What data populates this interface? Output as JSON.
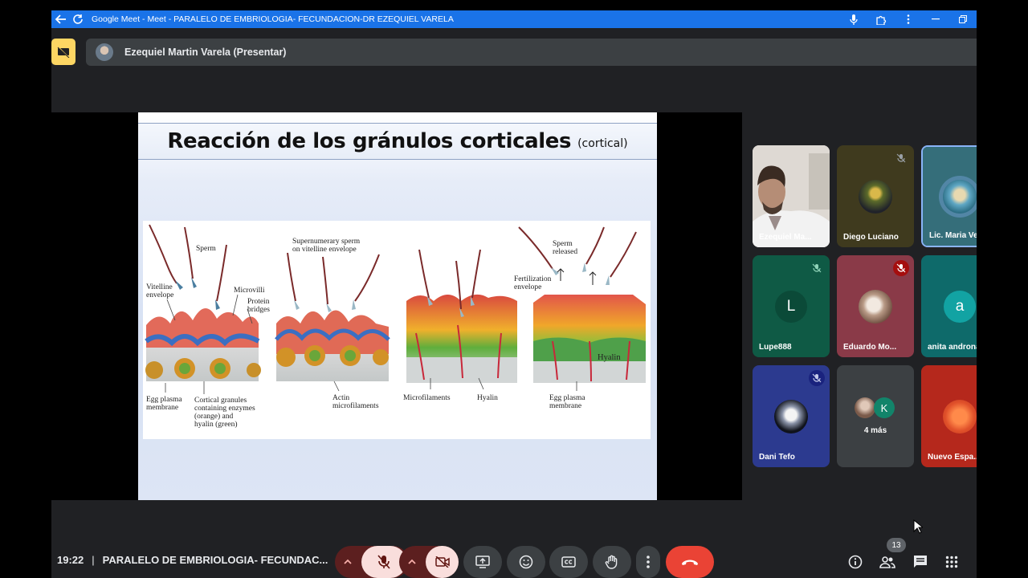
{
  "browser": {
    "title": "Google Meet - Meet - PARALELO DE EMBRIOLOGIA- FECUNDACION-DR EZEQUIEL VARELA",
    "back_icon": "arrow-left-icon",
    "reload_icon": "reload-icon",
    "accent_color": "#1a73e8"
  },
  "presenter": {
    "name": "Ezequiel Martin Varela (Presentar)",
    "toggle_color": "#fdd663"
  },
  "slide": {
    "title": "Reacción de los gránulos corticales",
    "title_suffix": "(cortical)",
    "figure_labels": {
      "sperm": "Sperm",
      "vitelline": "Vitelline\nenvelope",
      "microvilli": "Microvilli",
      "protein_bridges": "Protein\nbridges",
      "supernumerary": "Supernumerary sperm\non vitelline envelope",
      "sperm_released": "Sperm\nreleased",
      "fertilization_env": "Fertilization\nenvelope",
      "egg_membrane_1": "Egg plasma\nmembrane",
      "cortical_granules": "Cortical granules\ncontaining enzymes\n(orange) and\nhyalin (green)",
      "actin": "Actin\nmicrofilaments",
      "microfilaments": "Microfilaments",
      "hyalin": "Hyalin",
      "hyalin_layer": "Hyalin",
      "egg_membrane_2": "Egg plasma\nmembrane"
    }
  },
  "participants": [
    {
      "name": "Ezequiel Ma...",
      "type": "video",
      "muted": false
    },
    {
      "name": "Diego Luciano",
      "type": "photo",
      "muted": true,
      "bg": "#3f3a1e"
    },
    {
      "name": "Lic. Maria Ve...",
      "type": "photo",
      "muted": false,
      "bg": "#356e7a",
      "speaking": true
    },
    {
      "name": "Lupe888",
      "type": "letter",
      "letter": "L",
      "muted": true,
      "bg": "#0f5a45",
      "avatar_bg": "#0b4a38"
    },
    {
      "name": "Eduardo Mo...",
      "type": "photo",
      "muted": true,
      "bg": "#8a3a48"
    },
    {
      "name": "anita androna...",
      "type": "letter",
      "letter": "a",
      "muted": false,
      "bg": "#0e6a6a",
      "avatar_bg": "#12a3a3"
    },
    {
      "name": "Dani Tefo",
      "type": "photo",
      "muted": true,
      "bg": "#2c3a8f"
    },
    {
      "name": "4 más",
      "type": "more",
      "letter": "K",
      "bg": "#3c4043",
      "avatar_bg": "#12846a"
    },
    {
      "name": "Nuevo Espa...",
      "type": "photo",
      "muted": false,
      "bg": "#b5281c"
    }
  ],
  "bottom": {
    "time": "19:22",
    "separator": "|",
    "meeting_name": "PARALELO DE EMBRIOLOGIA- FECUNDAC...",
    "participant_count": "13",
    "danger_color": "#ea4335"
  }
}
